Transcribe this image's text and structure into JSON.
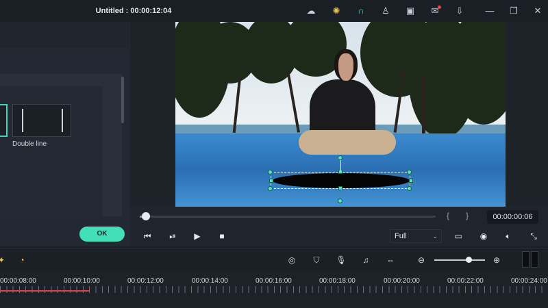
{
  "window": {
    "title": "Untitled : 00:00:12:04",
    "icons": [
      "cloud-icon",
      "bulb-icon",
      "headset-icon",
      "user-icon",
      "save-icon",
      "mail-icon",
      "download-icon",
      "minimize-icon",
      "restore-icon",
      "close-icon"
    ]
  },
  "left_panel": {
    "presets": [
      {
        "label": "",
        "selected": true
      },
      {
        "label": "Double line",
        "selected": false
      }
    ],
    "ok_label": "OK"
  },
  "player": {
    "timecode": "00:00:00:06",
    "quality": "Full",
    "progress": 0.02
  },
  "toolbar": {
    "icons": [
      "render-icon",
      "marker-icon",
      "mic-icon",
      "audio-list-icon",
      "fit-icon",
      "zoom-out-icon",
      "zoom-in-icon"
    ],
    "zoom_level": 0.68
  },
  "timeline": {
    "ruler_labels": [
      "00:00:08:00",
      "00:00:10:00",
      "00:00:12:00",
      "00:00:14:00",
      "00:00:16:00",
      "00:00:18:00",
      "00:00:20:00",
      "00:00:22:00",
      "00:00:24:00"
    ]
  },
  "colors": {
    "accent": "#43dfb9",
    "playhead": "#e0424c",
    "background": "#1b1f27"
  }
}
